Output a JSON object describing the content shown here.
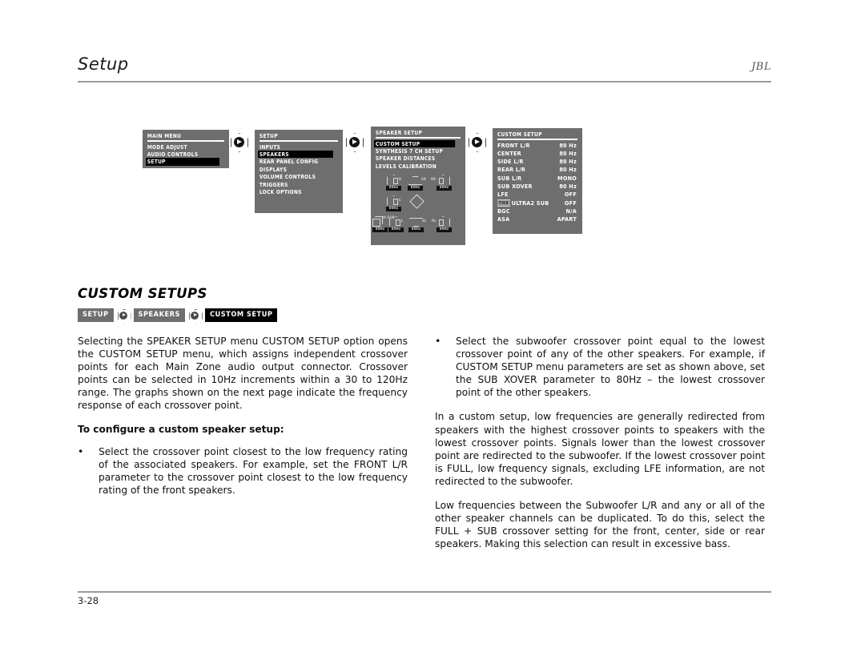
{
  "header": {
    "title": "Setup",
    "brand": "JBL"
  },
  "osd_screens": {
    "main_menu": {
      "title": "MAIN MENU",
      "items": [
        {
          "label": "MODE ADJUST",
          "selected": false
        },
        {
          "label": "AUDIO CONTROLS",
          "selected": false
        },
        {
          "label": "SETUP",
          "selected": true
        }
      ]
    },
    "setup": {
      "title": "SETUP",
      "items": [
        {
          "label": "INPUTS",
          "selected": false
        },
        {
          "label": "SPEAKERS",
          "selected": true
        },
        {
          "label": "REAR PANEL CONFIG",
          "selected": false
        },
        {
          "label": "DISPLAYS",
          "selected": false
        },
        {
          "label": "VOLUME CONTROLS",
          "selected": false
        },
        {
          "label": "TRIGGERS",
          "selected": false
        },
        {
          "label": "LOCK OPTIONS",
          "selected": false
        }
      ]
    },
    "speaker_setup": {
      "title": "SPEAKER SETUP",
      "items": [
        {
          "label": "CUSTOM SETUP",
          "selected": true
        },
        {
          "label": "SYNTHESIS 7 CH SETUP",
          "selected": false
        },
        {
          "label": "SPEAKER DISTANCES",
          "selected": false
        },
        {
          "label": "LEVELS CALIBRATION",
          "selected": false
        }
      ],
      "speaker_diagram": {
        "speakers": [
          {
            "id": "R",
            "label": "R",
            "freq": "80Hz"
          },
          {
            "id": "SR",
            "label": "SR",
            "freq": "80Hz"
          },
          {
            "id": "RR",
            "label": "RR",
            "freq": "80Hz"
          },
          {
            "id": "C",
            "label": "C",
            "freq": "80Hz"
          },
          {
            "id": "LIS",
            "label": "",
            "freq": ""
          },
          {
            "id": "SUB",
            "label": "M SUB",
            "freq": "80Hz"
          },
          {
            "id": "L",
            "label": "L",
            "freq": "80Hz"
          },
          {
            "id": "SL",
            "label": "SL",
            "freq": "80Hz"
          },
          {
            "id": "RL",
            "label": "RL",
            "freq": "80Hz"
          }
        ]
      }
    },
    "custom_setup": {
      "title": "CUSTOM SETUP",
      "rows": [
        {
          "param": "FRONT L/R",
          "value": "80 Hz",
          "badge": ""
        },
        {
          "param": "CENTER",
          "value": "80 Hz",
          "badge": ""
        },
        {
          "param": "SIDE L/R",
          "value": "80 Hz",
          "badge": ""
        },
        {
          "param": "REAR L/R",
          "value": "80 Hz",
          "badge": ""
        },
        {
          "param": "SUB L/R",
          "value": "MONO",
          "badge": ""
        },
        {
          "param": "SUB XOVER",
          "value": "80 Hz",
          "badge": ""
        },
        {
          "param": "LFE",
          "value": "OFF",
          "badge": ""
        },
        {
          "param": "ULTRA2 SUB",
          "value": "OFF",
          "badge": "THX"
        },
        {
          "param": "BGC",
          "value": "N/A",
          "badge": ""
        },
        {
          "param": "ASA",
          "value": "APART",
          "badge": ""
        }
      ]
    }
  },
  "navigation_arrows": {
    "icon": "right-arrow-icon",
    "count": 3
  },
  "section": {
    "heading": "CUSTOM SETUPS",
    "breadcrumb": [
      {
        "label": "SETUP",
        "style": "grey"
      },
      {
        "label": "SPEAKERS",
        "style": "grey"
      },
      {
        "label": "CUSTOM SETUP",
        "style": "black"
      }
    ]
  },
  "left_column": {
    "intro_paragraph": "Selecting the SPEAKER SETUP menu CUSTOM SETUP option opens the CUSTOM SETUP menu, which assigns independent crossover points for each Main Zone audio output connector. Crossover points can be selected in 10Hz increments within a 30 to 120Hz range. The graphs shown on the next page indicate the frequency response of each crossover point.",
    "subheading": "To configure a custom speaker setup:",
    "bullet_marker": "•",
    "bullet_1": "Select the crossover point closest to the low frequency rating of the associated speakers. For example, set the FRONT L/R parameter to the crossover point closest to the low frequency rating of the front speakers."
  },
  "right_column": {
    "bullet_marker": "•",
    "bullet_1": "Select the subwoofer crossover point equal to the lowest crossover point of any of the other speakers. For example, if CUSTOM SETUP menu parameters are set as shown above, set the SUB XOVER parameter to 80Hz – the lowest crossover point of the other speakers.",
    "paragraph_2": "In a custom setup, low frequencies are generally redirected from speakers with the highest crossover points to speakers with the lowest crossover points. Signals lower than the lowest crossover point are redirected to the subwoofer. If the lowest crossover point is FULL, low frequency signals, excluding LFE information, are not redirected to the subwoofer.",
    "paragraph_3": "Low frequencies between the Subwoofer L/R and any or all of the other speaker channels can be duplicated. To do this, select the FULL + SUB crossover setting for the front, center, side or rear speakers. Making this selection can result in excessive bass."
  },
  "footer": {
    "page_number": "3-28"
  },
  "colors": {
    "osd_background": "#6e6e6e",
    "osd_selected": "#000000",
    "rule": "#9a9a9a",
    "text": "#111111"
  }
}
